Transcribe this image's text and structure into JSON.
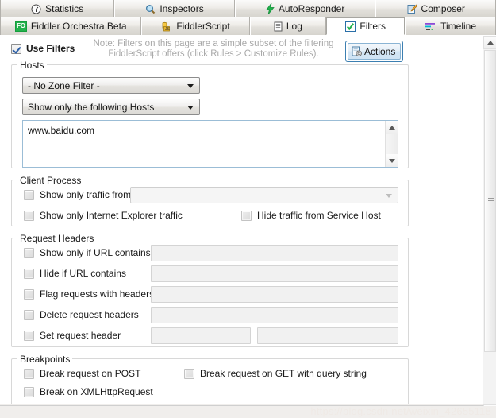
{
  "tabs_row1": [
    {
      "label": "Statistics",
      "icon": "clock-gauge-icon",
      "active": false
    },
    {
      "label": "Inspectors",
      "icon": "magnifier-icon",
      "active": false
    },
    {
      "label": "AutoResponder",
      "icon": "lightning-bolt-icon",
      "active": false
    },
    {
      "label": "Composer",
      "icon": "pencil-note-icon",
      "active": false
    }
  ],
  "tabs_row2": [
    {
      "label": "Fiddler Orchestra Beta",
      "icon": "fo-badge-icon",
      "active": false
    },
    {
      "label": "FiddlerScript",
      "icon": "js-scroll-icon",
      "active": false
    },
    {
      "label": "Log",
      "icon": "document-icon",
      "active": false
    },
    {
      "label": "Filters",
      "icon": "green-check-icon",
      "active": true
    },
    {
      "label": "Timeline",
      "icon": "timeline-bars-icon",
      "active": false
    }
  ],
  "toolbar": {
    "use_filters_label": "Use Filters",
    "use_filters_checked": true,
    "note_line1": "Note: Filters on this page are a simple subset of the filtering",
    "note_line2": "FiddlerScript offers (click Rules > Customize Rules).",
    "actions_label": "Actions",
    "actions_icon": "gear-document-icon"
  },
  "hosts": {
    "legend": "Hosts",
    "zone_filter_value": "- No Zone Filter -",
    "host_filter_value": "Show only the following Hosts",
    "host_list_value": "www.baidu.com"
  },
  "client_process": {
    "legend": "Client Process",
    "show_only_traffic_from_label": "Show only traffic from",
    "show_only_traffic_from_checked": false,
    "process_combo_value": "",
    "show_only_ie_label": "Show only Internet Explorer traffic",
    "show_only_ie_checked": false,
    "hide_service_host_label": "Hide traffic from Service Host",
    "hide_service_host_checked": false
  },
  "request_headers": {
    "legend": "Request Headers",
    "rows": [
      {
        "label": "Show only if URL contains",
        "checked": false,
        "value": ""
      },
      {
        "label": "Hide if URL contains",
        "checked": false,
        "value": ""
      },
      {
        "label": "Flag requests with headers",
        "checked": false,
        "value": ""
      },
      {
        "label": "Delete request headers",
        "checked": false,
        "value": ""
      },
      {
        "label": "Set request header",
        "checked": false,
        "value": "",
        "value2": ""
      }
    ]
  },
  "breakpoints": {
    "legend": "Breakpoints",
    "break_post_label": "Break request on POST",
    "break_post_checked": false,
    "break_get_label": "Break request on GET with query string",
    "break_get_checked": false,
    "break_xhr_label": "Break on XMLHttpRequest",
    "break_xhr_checked": false
  },
  "watermark": "https://blog.csdn.net/weixin_42655118",
  "colors": {
    "accent_blue": "#3c7fb1",
    "check_green": "#22b14c",
    "note_gray": "#a9a9a9",
    "field_border": "#9bbdd6"
  }
}
